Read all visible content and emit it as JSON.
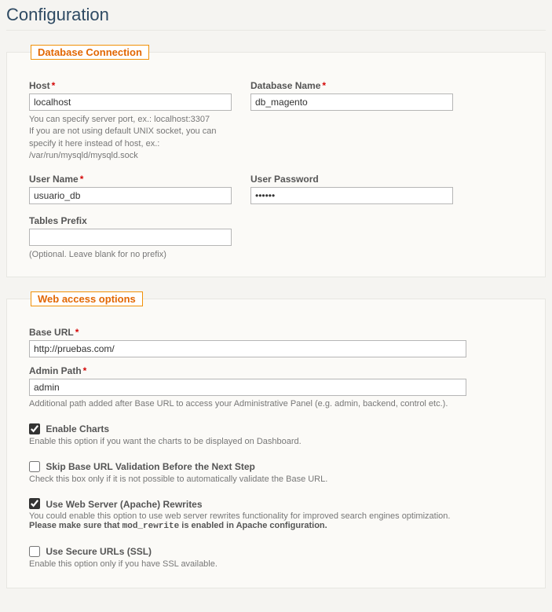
{
  "page": {
    "title": "Configuration"
  },
  "db": {
    "legend": "Database Connection",
    "host_label": "Host",
    "host_value": "localhost",
    "host_hint": "You can specify server port, ex.: localhost:3307\nIf you are not using default UNIX socket, you can specify it here instead of host, ex.: /var/run/mysqld/mysqld.sock",
    "dbname_label": "Database Name",
    "dbname_value": "db_magento",
    "user_label": "User Name",
    "user_value": "usuario_db",
    "password_label": "User Password",
    "password_value": "••••••",
    "prefix_label": "Tables Prefix",
    "prefix_value": "",
    "prefix_hint": "(Optional. Leave blank for no prefix)",
    "required_mark": "*"
  },
  "web": {
    "legend": "Web access options",
    "baseurl_label": "Base URL",
    "baseurl_value": "http://pruebas.com/",
    "admin_label": "Admin Path",
    "admin_value": "admin",
    "admin_hint": "Additional path added after Base URL to access your Administrative Panel (e.g. admin, backend, control etc.).",
    "charts_label": "Enable Charts",
    "charts_checked": true,
    "charts_hint": "Enable this option if you want the charts to be displayed on Dashboard.",
    "skip_label": "Skip Base URL Validation Before the Next Step",
    "skip_checked": false,
    "skip_hint": "Check this box only if it is not possible to automatically validate the Base URL.",
    "rewrites_label": "Use Web Server (Apache) Rewrites",
    "rewrites_checked": true,
    "rewrites_hint_text": "You could enable this option to use web server rewrites functionality for improved search engines optimization.",
    "rewrites_hint_bold_pre": "Please make sure that ",
    "rewrites_hint_code": "mod_rewrite",
    "rewrites_hint_bold_post": " is enabled in Apache configuration.",
    "ssl_label": "Use Secure URLs (SSL)",
    "ssl_checked": false,
    "ssl_hint": "Enable this option only if you have SSL available."
  }
}
